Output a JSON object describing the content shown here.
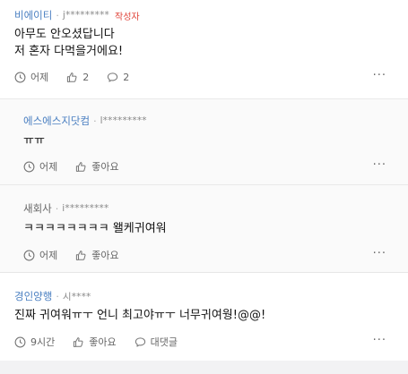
{
  "comments": [
    {
      "nickname": "비에이티",
      "user_id": "j*********",
      "badge": "작성자",
      "lines": [
        "아무도 안오셨답니다",
        "저 혼자 다먹을거에요!"
      ],
      "time": "어제",
      "likes": "2",
      "replies": "2"
    },
    {
      "nickname": "에스에스지닷컴",
      "user_id": "l*********",
      "lines": [
        "ㅠㅠ"
      ],
      "time": "어제",
      "like_label": "좋아요"
    },
    {
      "nickname": "새회사",
      "user_id": "i*********",
      "lines": [
        "ㅋㅋㅋㅋㅋㅋㅋㅋ 왤케귀여워"
      ],
      "time": "어제",
      "like_label": "좋아요"
    },
    {
      "nickname": "경인양행",
      "user_id": "시****",
      "lines": [
        "진짜 귀여워ㅠㅜ 언니 최고야ㅠㅜ 너무귀여웡!@@!"
      ],
      "time": "9시간",
      "like_label": "좋아요",
      "reply_label": "대댓글"
    }
  ],
  "more_label": "···",
  "colors": {
    "nickname": "#4a7fc1",
    "badge": "#e0463c",
    "reply_bg": "#fafafa"
  },
  "icons": [
    "clock-icon",
    "thumbs-up-icon",
    "speech-bubble-icon",
    "more-icon"
  ]
}
